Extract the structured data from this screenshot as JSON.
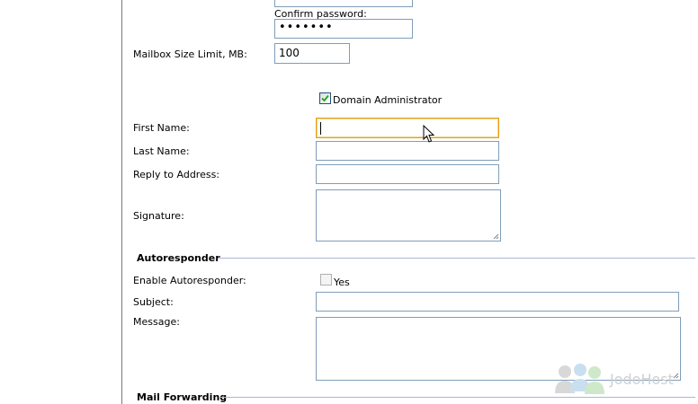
{
  "account": {
    "confirm_password_label": "Confirm password:",
    "confirm_password_value": "•••••••",
    "mailbox_size_label": "Mailbox Size Limit, MB:",
    "mailbox_size_value": "100",
    "domain_admin_label": "Domain Administrator",
    "domain_admin_checked": true
  },
  "profile": {
    "first_name_label": "First Name:",
    "last_name_label": "Last Name:",
    "reply_to_label": "Reply to Address:",
    "signature_label": "Signature:"
  },
  "autoresponder": {
    "section_title": "Autoresponder",
    "enable_label": "Enable Autoresponder:",
    "enable_option": "Yes",
    "enabled": false,
    "subject_label": "Subject:",
    "message_label": "Message:"
  },
  "mail_forwarding": {
    "section_title": "Mail Forwarding"
  },
  "watermark": {
    "text": "JodoHost"
  },
  "colors": {
    "focus_border": "#e3a21a",
    "input_border": "#7f9db9",
    "section_rule": "#a9b7d6"
  }
}
